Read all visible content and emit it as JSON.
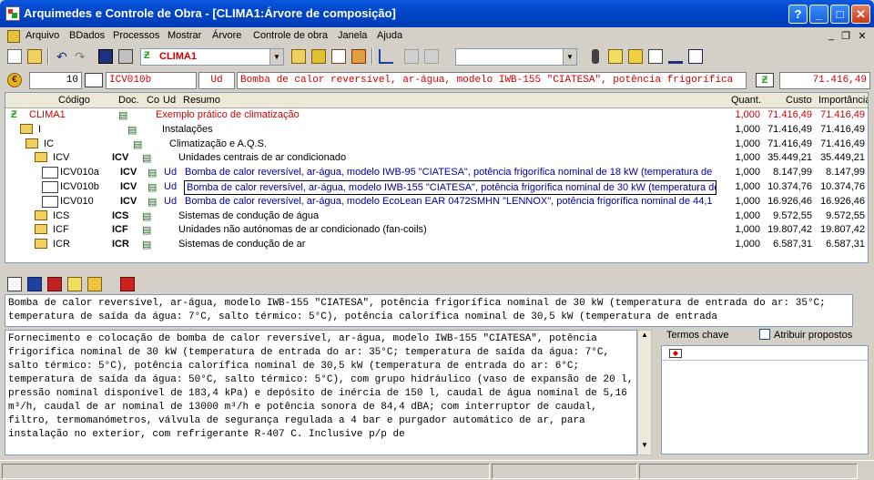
{
  "window": {
    "title": "Arquimedes e Controle de Obra - [CLIMA1:Árvore de composição]",
    "help_btn": "?",
    "min_btn": "_",
    "max_btn": "□",
    "close_btn": "✕"
  },
  "menu": [
    "Arquivo",
    "BDados",
    "Processos",
    "Mostrar",
    "Árvore",
    "Controle de obra",
    "Janela",
    "Ajuda"
  ],
  "mdi_controls": {
    "min": "_",
    "restore": "❐",
    "close": "✕"
  },
  "toolbar": {
    "project_combo": "CLIMA1"
  },
  "info": {
    "level": "10",
    "code": "ICV010b",
    "unit": "Ud",
    "summary": "Bomba de calor reversível, ar-água, modelo IWB-155 \"CIATESA\", potência frigorífica",
    "amount": "71.416,49"
  },
  "table": {
    "headers": {
      "code": "Código",
      "doc": "Doc.",
      "co": "Co",
      "ud": "Ud",
      "summary": "Resumo",
      "qty": "Quant.",
      "cost": "Custo",
      "amount": "Importância"
    },
    "rows": [
      {
        "code": "CLIMA1",
        "doc": "",
        "ud": "",
        "summary": "Exemplo prático de climatização",
        "qty": "1,000",
        "cost": "71.416,49",
        "amount": "71.416,49"
      },
      {
        "code": "I",
        "doc": "",
        "ud": "",
        "summary": "Instalações",
        "qty": "1,000",
        "cost": "71.416,49",
        "amount": "71.416,49"
      },
      {
        "code": "IC",
        "doc": "",
        "ud": "",
        "summary": "Climatização e A.Q.S.",
        "qty": "1,000",
        "cost": "71.416,49",
        "amount": "71.416,49"
      },
      {
        "code": "ICV",
        "doc": "ICV",
        "ud": "",
        "summary": "Unidades centrais de ar condicionado",
        "qty": "1,000",
        "cost": "35.449,21",
        "amount": "35.449,21"
      },
      {
        "code": "ICV010a",
        "doc": "ICV",
        "ud": "Ud",
        "summary": "Bomba de calor reversível, ar-água, modelo IWB-95 \"CIATESA\", potência frigorífica nominal de 18 kW (temperatura de ent",
        "qty": "1,000",
        "cost": "8.147,99",
        "amount": "8.147,99"
      },
      {
        "code": "ICV010b",
        "doc": "ICV",
        "ud": "Ud",
        "summary": "Bomba de calor reversível, ar-água, modelo IWB-155 \"CIATESA\", potência frigorífica nominal de 30 kW (temperatura de en",
        "qty": "1,000",
        "cost": "10.374,76",
        "amount": "10.374,76"
      },
      {
        "code": "ICV010",
        "doc": "ICV",
        "ud": "Ud",
        "summary": "Bomba de calor reversível, ar-água, modelo EcoLean EAR 0472SMHN \"LENNOX\", potência frigorífica nominal de 44,1 k",
        "qty": "1,000",
        "cost": "16.926,46",
        "amount": "16.926,46"
      },
      {
        "code": "ICS",
        "doc": "ICS",
        "ud": "",
        "summary": "Sistemas de condução de água",
        "qty": "1,000",
        "cost": "9.572,55",
        "amount": "9.572,55"
      },
      {
        "code": "ICF",
        "doc": "ICF",
        "ud": "",
        "summary": "Unidades não autónomas de ar condicionado (fan-coils)",
        "qty": "1,000",
        "cost": "19.807,42",
        "amount": "19.807,42"
      },
      {
        "code": "ICR",
        "doc": "ICR",
        "ud": "",
        "summary": "Sistemas de condução de ar",
        "qty": "1,000",
        "cost": "6.587,31",
        "amount": "6.587,31"
      }
    ]
  },
  "summary_text": "Bomba de calor reversível, ar-água, modelo IWB-155 \"CIATESA\", potência frigorífica nominal de 30 kW (temperatura de entrada do ar: 35°C; temperatura de saída da água: 7°C, salto térmico: 5°C), potência calorífica nominal de 30,5 kW (temperatura de entrada",
  "description_text": "Fornecimento e colocação de bomba de calor reversível, ar-água, modelo IWB-155 \"CIATESA\", potência frigorífica nominal de 30 kW (temperatura de entrada do ar: 35°C; temperatura de saída da água: 7°C, salto térmico: 5°C), potência calorífica nominal de 30,5 kW (temperatura de entrada do ar: 6°C; temperatura de saída da água: 50°C, salto térmico: 5°C), com grupo hidráulico (vaso de expansão de 20 l, pressão nominal disponível de 183,4 kPa) e depósito de inércia de 150 l, caudal de água nominal de 5,16 m³/h, caudal de ar nominal de 13000 m³/h e potência sonora de 84,4 dBA; com interruptor de caudal, filtro, termomanómetros, válvula de segurança regulada a 4 bar e purgador automático de ar, para instalação no exterior, com refrigerante R-407 C. Inclusive p/p de",
  "keywords": {
    "label": "Termos chave",
    "checkbox_label": "Atribuir propostos"
  },
  "colors": {
    "titlebar": "#0046c8",
    "accent_red": "#d00000",
    "link_blue": "#0000a0"
  }
}
